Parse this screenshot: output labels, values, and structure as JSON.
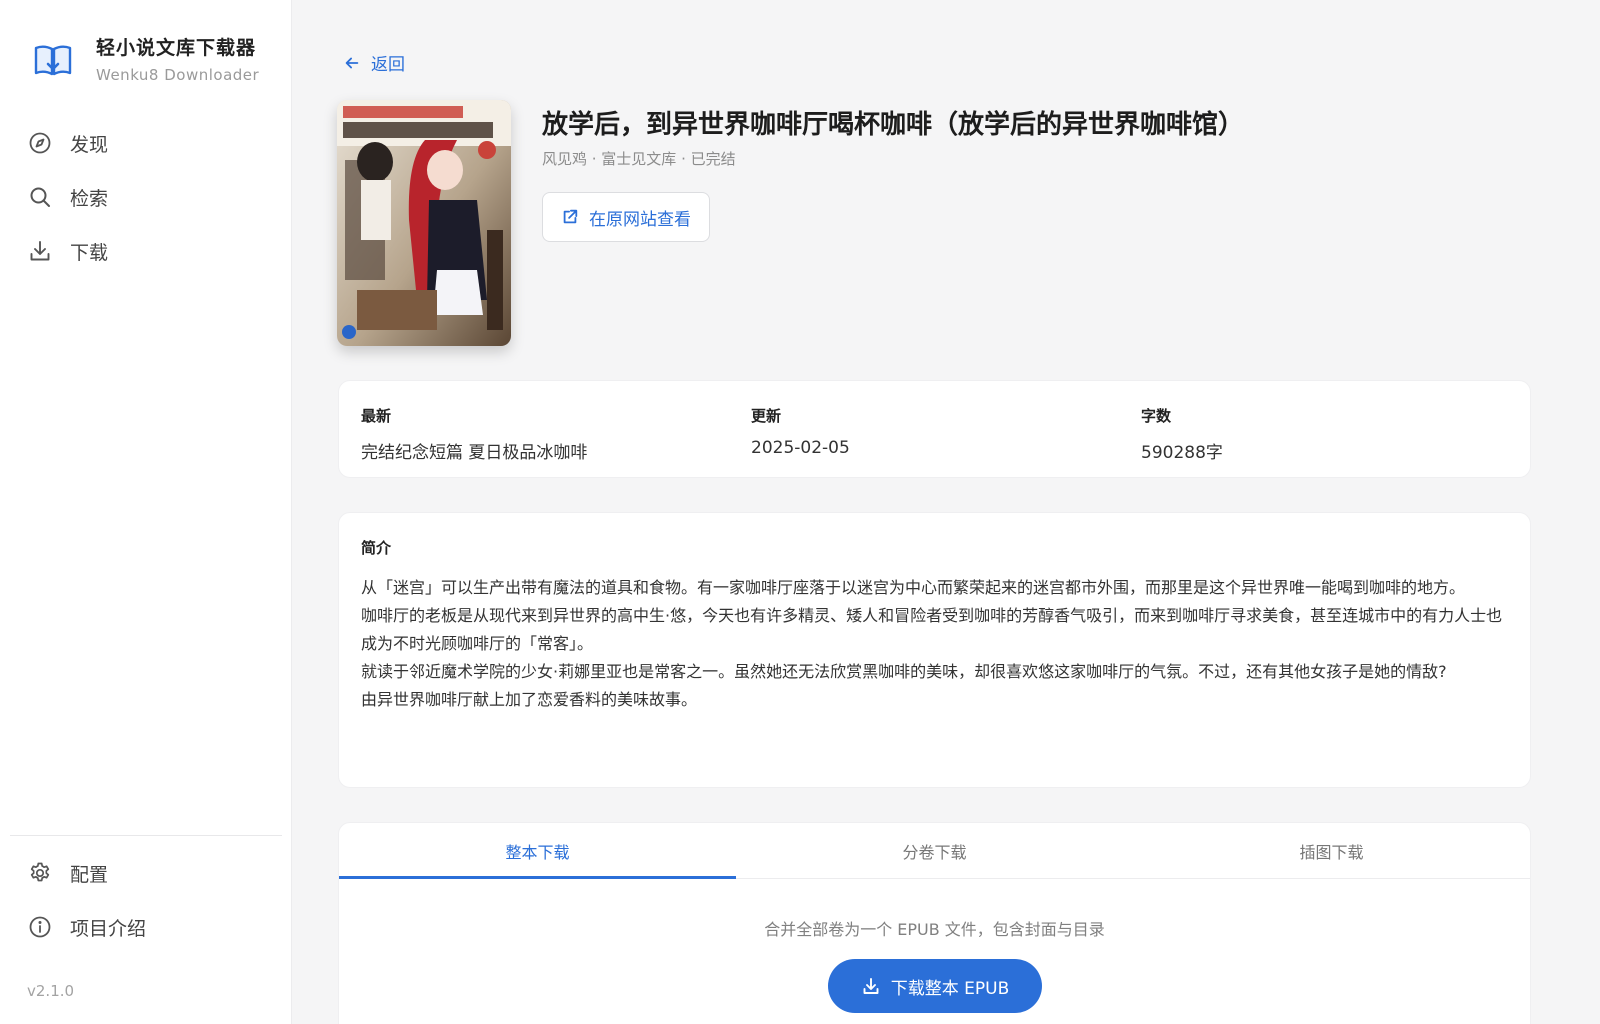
{
  "app": {
    "title": "轻小说文库下载器",
    "subtitle": "Wenku8 Downloader",
    "version": "v2.1.0",
    "accent_color": "#2b6fd8"
  },
  "sidebar": {
    "items": [
      {
        "label": "发现",
        "icon": "compass-icon"
      },
      {
        "label": "检索",
        "icon": "search-icon"
      },
      {
        "label": "下载",
        "icon": "download-icon"
      }
    ],
    "bottom_items": [
      {
        "label": "配置",
        "icon": "gear-icon"
      },
      {
        "label": "项目介绍",
        "icon": "info-icon"
      }
    ]
  },
  "back_label": "返回",
  "book": {
    "title": "放学后，到异世界咖啡厅喝杯咖啡（放学后的异世界咖啡馆）",
    "meta": "风见鸡 · 富士见文库 · 已完结",
    "external_link_label": "在原网站查看"
  },
  "info": {
    "latest_label": "最新",
    "latest_value": "完结纪念短篇 夏日极品冰咖啡",
    "updated_label": "更新",
    "updated_value": "2025-02-05",
    "words_label": "字数",
    "words_value": "590288字"
  },
  "intro": {
    "title": "简介",
    "paragraphs": [
      "从「迷宫」可以生产出带有魔法的道具和食物。有一家咖啡厅座落于以迷宫为中心而繁荣起来的迷宫都市外围，而那里是这个异世界唯一能喝到咖啡的地方。",
      "咖啡厅的老板是从现代来到异世界的高中生·悠，今天也有许多精灵、矮人和冒险者受到咖啡的芳醇香气吸引，而来到咖啡厅寻求美食，甚至连城市中的有力人士也成为不时光顾咖啡厅的「常客」。",
      "就读于邻近魔术学院的少女·莉娜里亚也是常客之一。虽然她还无法欣赏黑咖啡的美味，却很喜欢悠这家咖啡厅的气氛。不过，还有其他女孩子是她的情敌?",
      "由异世界咖啡厅献上加了恋爱香料的美味故事。"
    ]
  },
  "download": {
    "tabs": [
      "整本下载",
      "分卷下载",
      "插图下载"
    ],
    "active_tab": 0,
    "description": "合并全部卷为一个 EPUB 文件，包含封面与目录",
    "button_label": "下载整本 EPUB"
  }
}
